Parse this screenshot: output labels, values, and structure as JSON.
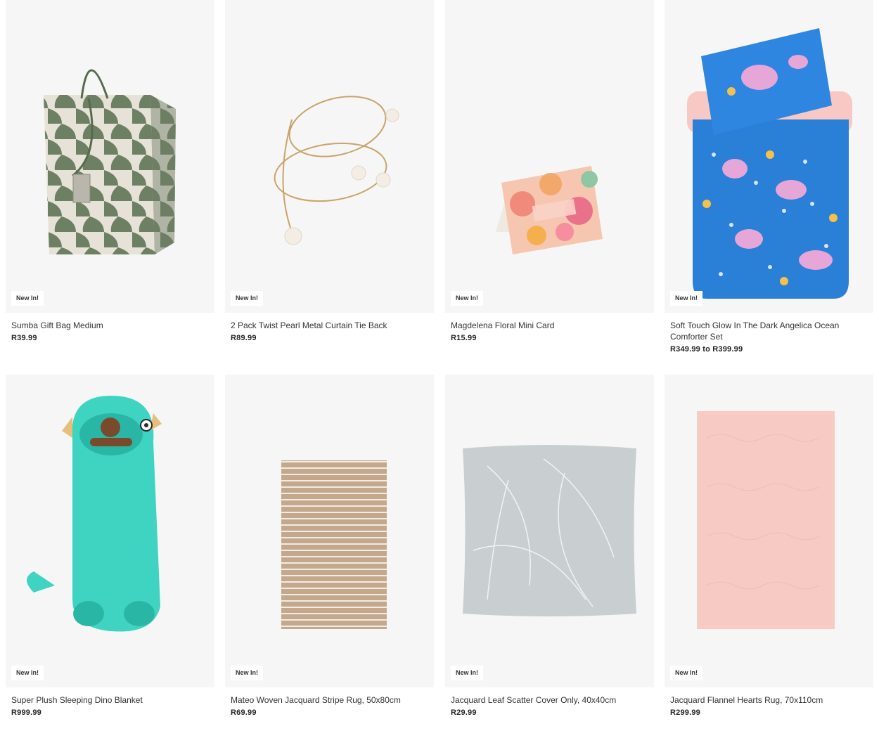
{
  "products": [
    {
      "badge": "New In!",
      "title": "Sumba Gift Bag Medium",
      "price": "R39.99",
      "image_icon": "gift-bag-image"
    },
    {
      "badge": "New In!",
      "title": "2 Pack Twist Pearl Metal Curtain Tie Back",
      "price": "R89.99",
      "image_icon": "curtain-tie-back-image"
    },
    {
      "badge": "New In!",
      "title": "Magdelena Floral Mini Card",
      "price": "R15.99",
      "image_icon": "floral-card-image"
    },
    {
      "badge": "New In!",
      "title": "Soft Touch Glow In The Dark Angelica Ocean Comforter Set",
      "price": "R349.99 to R399.99",
      "image_icon": "comforter-set-image"
    },
    {
      "badge": "New In!",
      "title": "Super Plush Sleeping Dino Blanket",
      "price": "R999.99",
      "image_icon": "dino-sleeping-bag-image"
    },
    {
      "badge": "New In!",
      "title": "Mateo Woven Jacquard Stripe Rug, 50x80cm",
      "price": "R69.99",
      "image_icon": "stripe-rug-image"
    },
    {
      "badge": "New In!",
      "title": "Jacquard Leaf Scatter Cover Only, 40x40cm",
      "price": "R29.99",
      "image_icon": "leaf-cushion-image"
    },
    {
      "badge": "New In!",
      "title": "Jacquard Flannel Hearts Rug, 70x110cm",
      "price": "R299.99",
      "image_icon": "pink-rug-image"
    }
  ],
  "colors": {
    "card_bg": "#f6f6f6",
    "badge_bg": "#ffffff",
    "text": "#333333",
    "gift_bag_green": "#6d8063",
    "comforter_blue": "#2a7fd6",
    "dino_teal": "#3fd4c2",
    "rug_tan": "#c4a88c",
    "cushion_grey": "#c9ced0",
    "rug_pink": "#f7cbc3"
  }
}
